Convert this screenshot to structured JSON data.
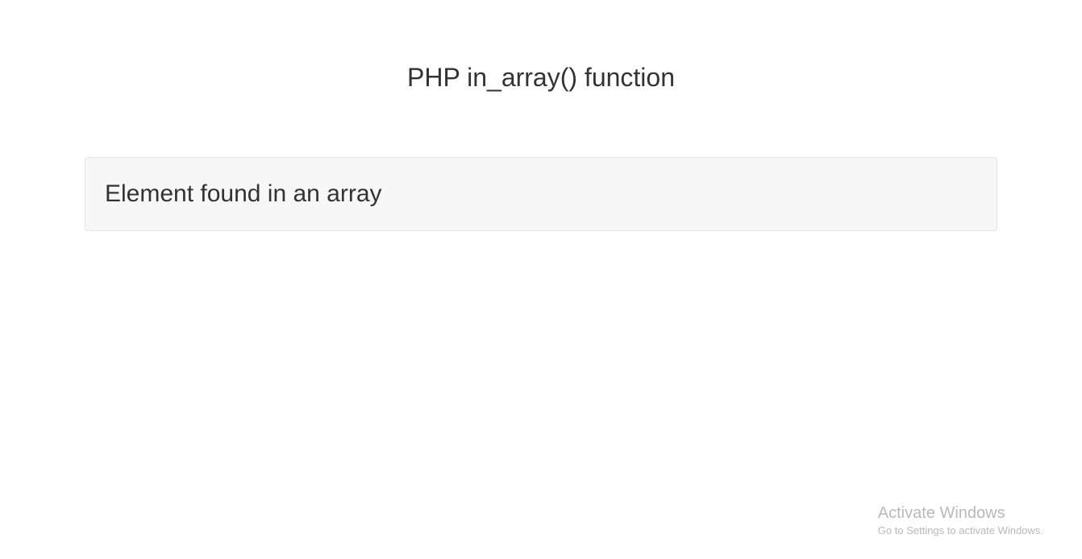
{
  "header": {
    "title": "PHP in_array() function"
  },
  "main": {
    "result_message": "Element found in an array"
  },
  "watermark": {
    "title": "Activate Windows",
    "subtitle": "Go to Settings to activate Windows."
  }
}
